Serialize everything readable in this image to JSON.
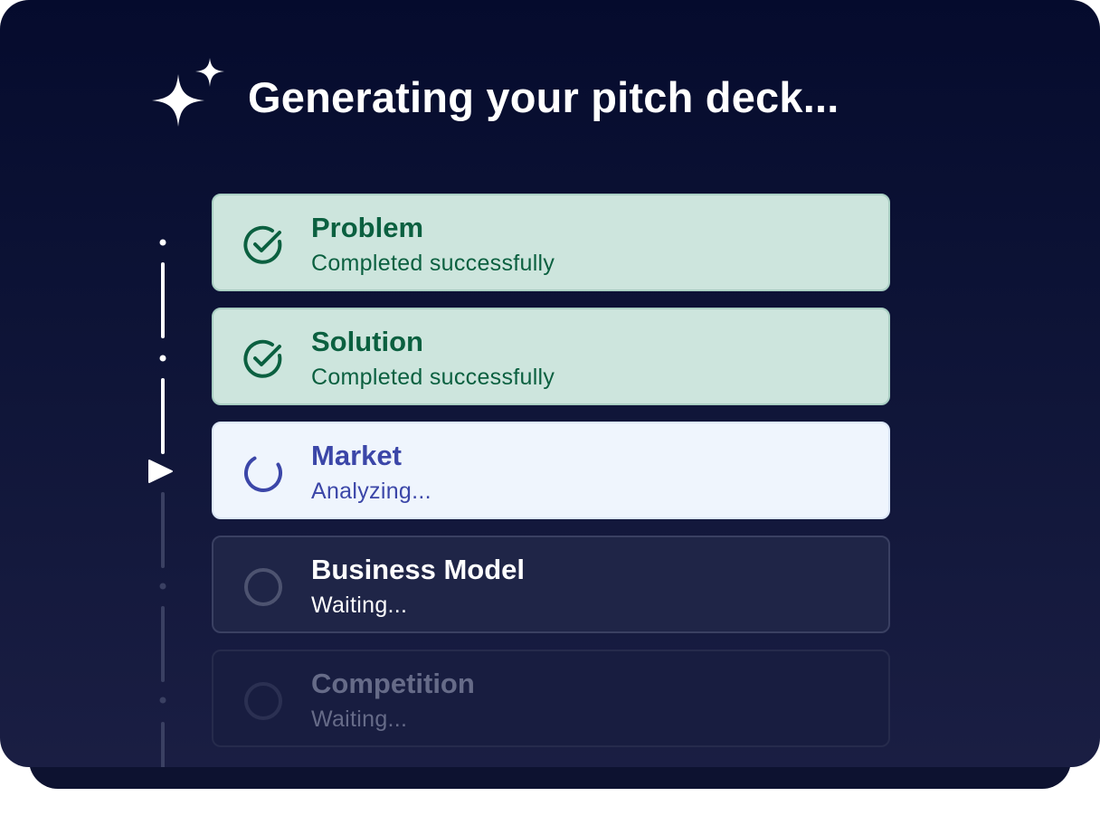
{
  "title": "Generating your pitch deck...",
  "steps": [
    {
      "name": "Problem",
      "status": "Completed successfully",
      "state": "done"
    },
    {
      "name": "Solution",
      "status": "Completed successfully",
      "state": "done"
    },
    {
      "name": "Market",
      "status": "Analyzing...",
      "state": "active"
    },
    {
      "name": "Business Model",
      "status": "Waiting...",
      "state": "waiting"
    },
    {
      "name": "Competition",
      "status": "Waiting...",
      "state": "waiting"
    }
  ],
  "icons": {
    "header": "sparkle-icon",
    "done": "check-circle-icon",
    "active": "spinner-icon",
    "waiting": "empty-circle-icon",
    "current_marker": "play-marker-icon"
  },
  "colors": {
    "background": "#0e1437",
    "done_bg": "#cde5dd",
    "done_text": "#0b6040",
    "active_bg": "#eff5fd",
    "active_text": "#3b46a8",
    "waiting_bg": "#1f2547"
  }
}
